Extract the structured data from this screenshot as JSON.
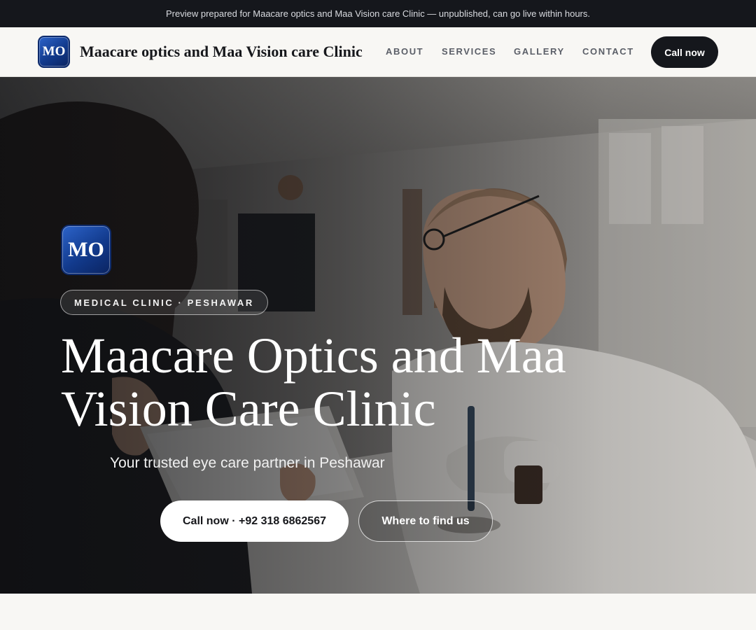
{
  "preview_banner": {
    "text": "Preview prepared for Maacare optics and Maa Vision care Clinic — unpublished, can go live within hours."
  },
  "header": {
    "logo_text": "MO",
    "brand_name": "Maacare optics and Maa Vision care Clinic",
    "nav": [
      {
        "label": "ABOUT"
      },
      {
        "label": "SERVICES"
      },
      {
        "label": "GALLERY"
      },
      {
        "label": "CONTACT"
      }
    ],
    "cta_label": "Call now"
  },
  "hero": {
    "logo_text": "MO",
    "eyebrow": "MEDICAL CLINIC · PESHAWAR",
    "title": "Maacare Optics and Maa Vision Care Clinic",
    "subtitle": "Your trusted eye care partner in Peshawar",
    "primary_button": "Call now · +92 318 6862567",
    "secondary_button": "Where to find us"
  },
  "colors": {
    "dark": "#15171c",
    "page_background": "#f8f7f4",
    "logo_blue": "#123a8c",
    "white": "#ffffff"
  },
  "icons": {
    "header_logo": "mo-logo-icon",
    "hero_logo": "mo-logo-icon"
  }
}
